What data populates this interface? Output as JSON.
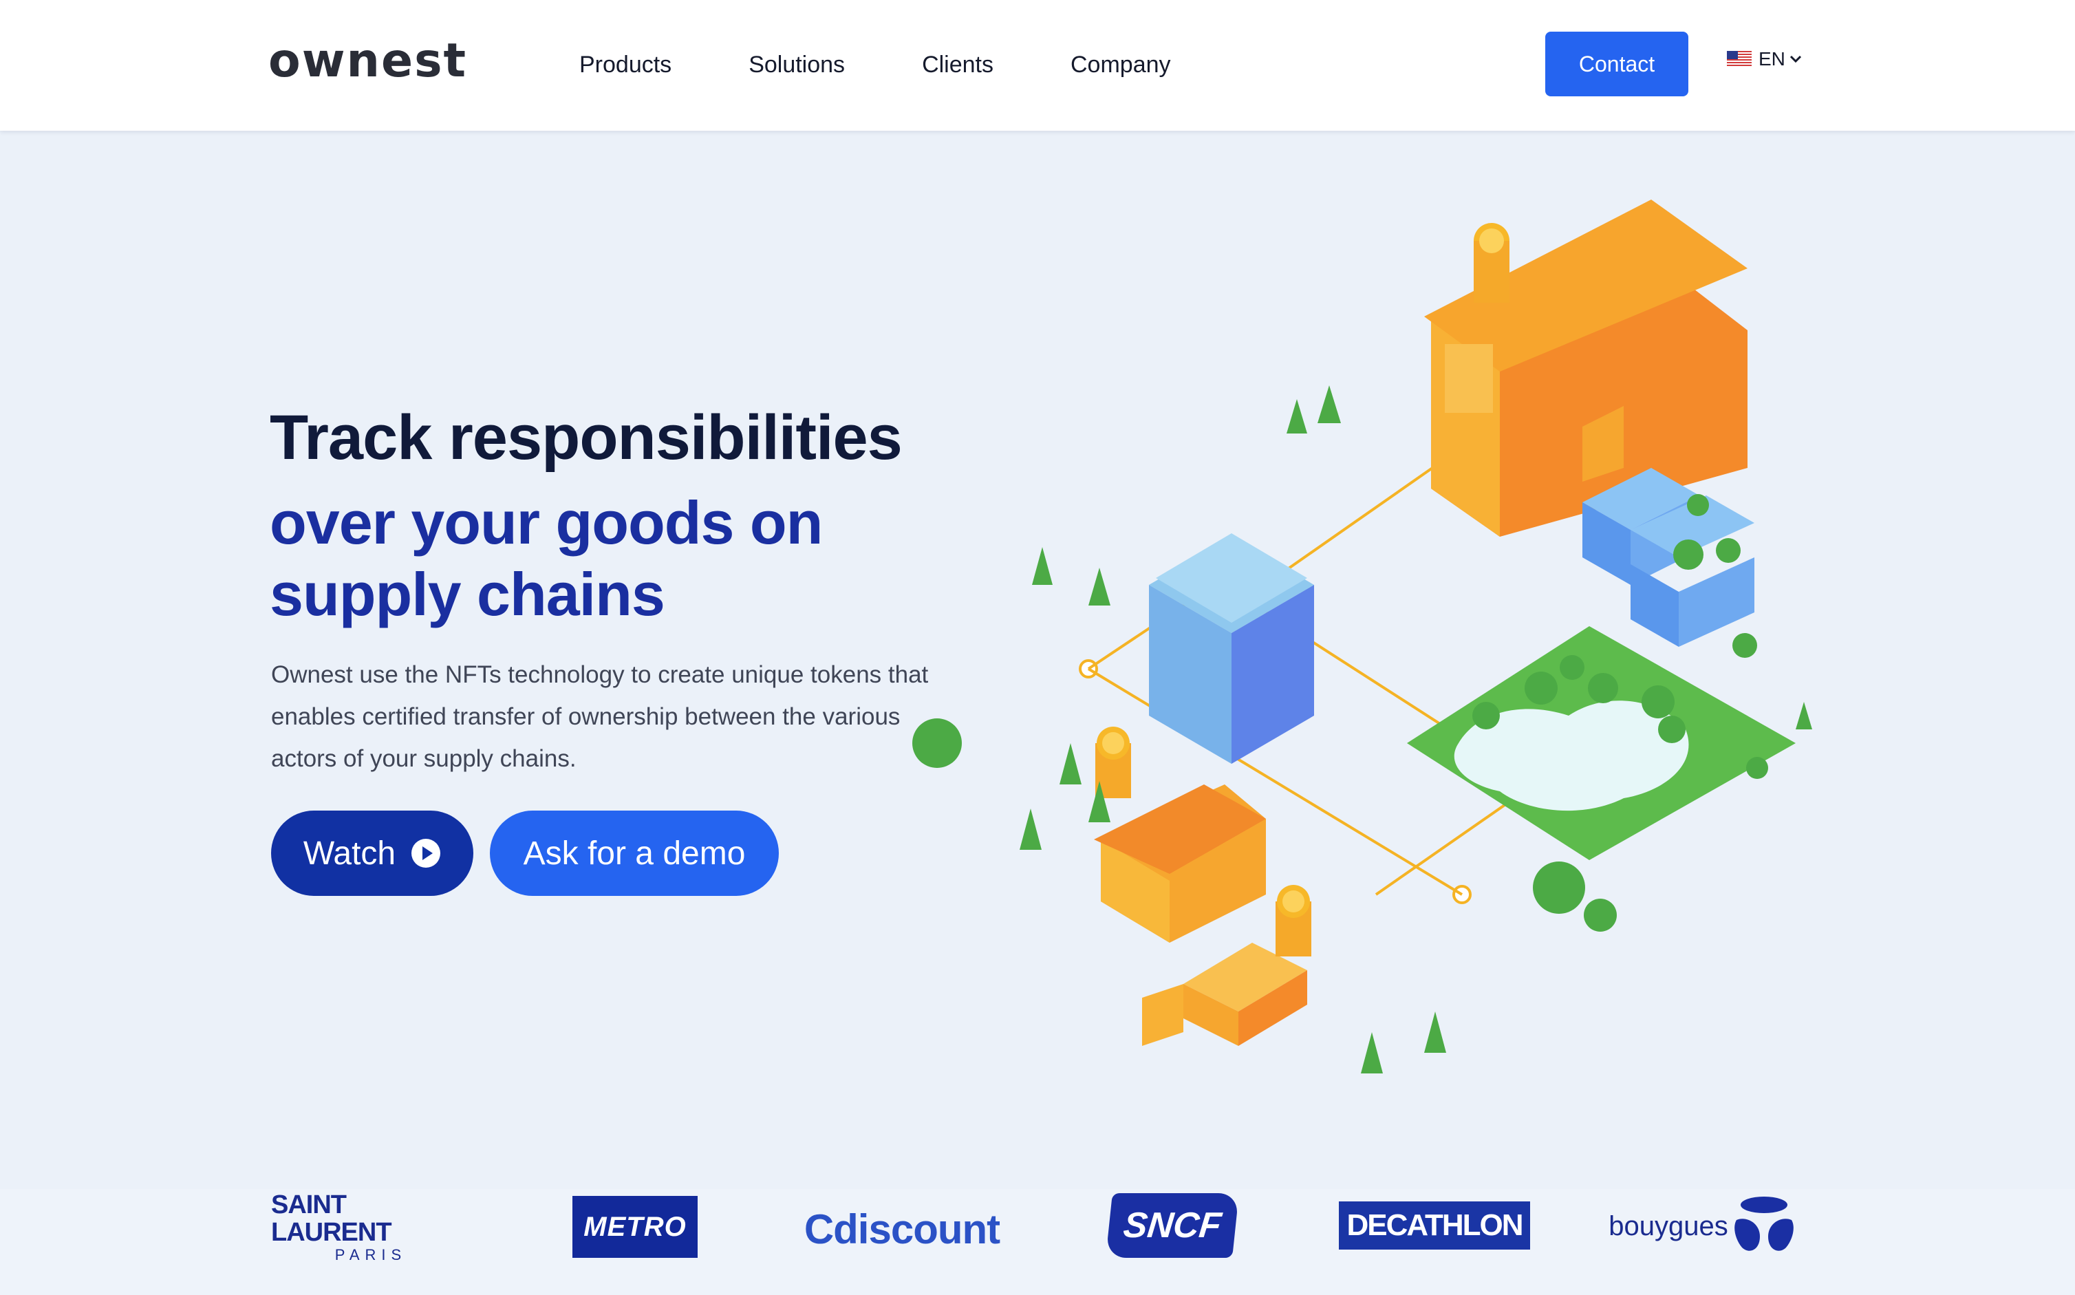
{
  "header": {
    "logo": "ownest",
    "nav": [
      "Products",
      "Solutions",
      "Clients",
      "Company"
    ],
    "contact_label": "Contact",
    "language": "EN"
  },
  "hero": {
    "title_line1": "Track responsibilities",
    "title_line2": "over your goods on supply chains",
    "description": "Ownest use the NFTs technology to create unique tokens that enables certified transfer of ownership between the various actors of your supply chains.",
    "watch_label": "Watch",
    "demo_label": "Ask for a demo"
  },
  "clients": {
    "ysl_line1": "SAINT LAURENT",
    "ysl_line2": "PARIS",
    "metro": "METRO",
    "cdiscount": "Cdiscount",
    "sncf": "SNCF",
    "decathlon": "DECATHLON",
    "bouygues": "bouygues"
  },
  "colors": {
    "primary": "#2564f0",
    "dark_blue": "#1131a3",
    "background": "#ebf1f9"
  }
}
